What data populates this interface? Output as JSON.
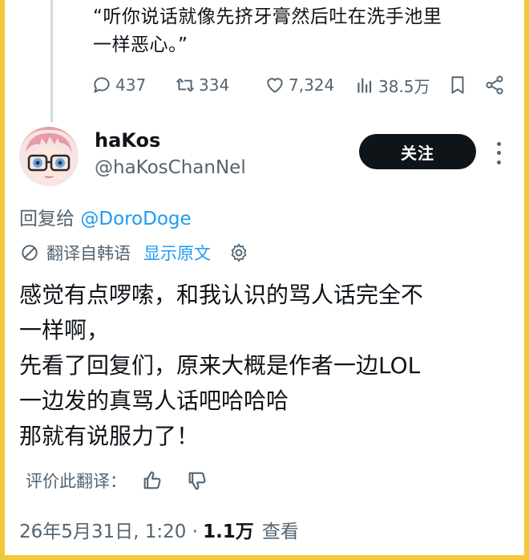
{
  "quoted_text": {
    "line1": "“听你说话就像先挤牙膏然后吐在洗手池里",
    "line2": "一样恶心。”"
  },
  "quoted_actions": {
    "replies": "437",
    "reposts": "334",
    "likes": "7,324",
    "views": "38.5万"
  },
  "user": {
    "name": "haKos",
    "handle": "@haKosChanNel",
    "follow_label": "关注"
  },
  "reply_to": {
    "prefix": "回复给",
    "mention": "@DoroDoge"
  },
  "translation": {
    "label": "翻译自韩语",
    "show_original": "显示原文"
  },
  "post_lines": [
    "感觉有点啰嗦，和我认识的骂人话完全不",
    "一样啊，",
    "先看了回复们，原来大概是作者一边LOL",
    "一边发的真骂人话吧哈哈哈",
    "那就有说服力了！"
  ],
  "rate_translation": {
    "label": "评价此翻译："
  },
  "meta": {
    "timestamp": "26年5月31日, 1:20 ·",
    "views": "1.1万",
    "views_label": "查看"
  },
  "colors": {
    "background_border": "#f4c63a",
    "text": "#0f1419",
    "secondary": "#536471",
    "link": "#1d9bf0",
    "follow_button": "#0f1419"
  }
}
